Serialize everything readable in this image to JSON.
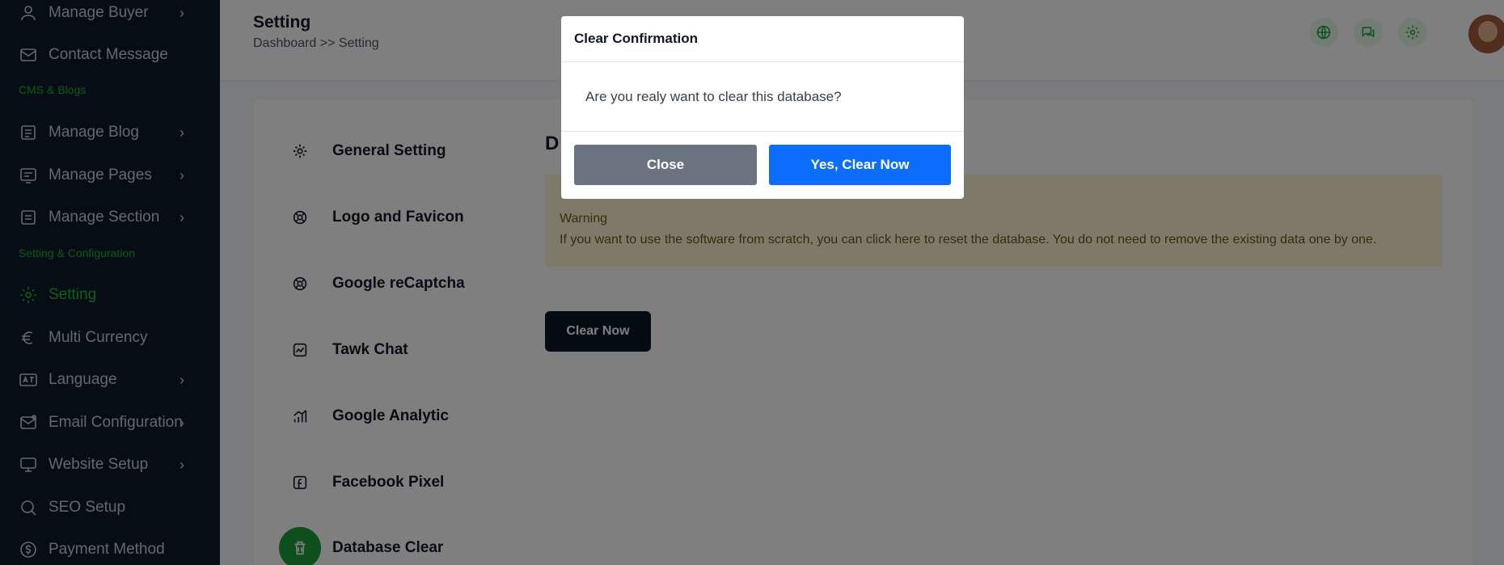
{
  "sidebar": {
    "items": [
      {
        "label": "Manage Buyer",
        "icon": "user-icon",
        "chevron": "›"
      },
      {
        "label": "Contact Message",
        "icon": "mail-icon",
        "chevron": ""
      },
      {
        "label": "Manage Blog",
        "icon": "blog-icon",
        "chevron": "›"
      },
      {
        "label": "Manage Pages",
        "icon": "pages-icon",
        "chevron": "›"
      },
      {
        "label": "Manage Section",
        "icon": "section-icon",
        "chevron": "›"
      },
      {
        "label": "Setting",
        "icon": "gear-icon",
        "chevron": ""
      },
      {
        "label": "Multi Currency",
        "icon": "currency-icon",
        "chevron": ""
      },
      {
        "label": "Language",
        "icon": "language-icon",
        "chevron": "›"
      },
      {
        "label": "Email Configuration",
        "icon": "email-config-icon",
        "chevron": "›"
      },
      {
        "label": "Website Setup",
        "icon": "monitor-icon",
        "chevron": "›"
      },
      {
        "label": "SEO Setup",
        "icon": "search-icon",
        "chevron": ""
      },
      {
        "label": "Payment Method",
        "icon": "dollar-icon",
        "chevron": ""
      }
    ],
    "sections": {
      "cms": "CMS & Blogs",
      "setting": "Setting & Configuration"
    }
  },
  "header": {
    "title": "Setting",
    "breadcrumb": "Dashboard >> Setting"
  },
  "settings_nav": [
    {
      "label": "General Setting",
      "icon": "gear-icon"
    },
    {
      "label": "Logo and Favicon",
      "icon": "logo-icon"
    },
    {
      "label": "Google reCaptcha",
      "icon": "recaptcha-icon"
    },
    {
      "label": "Tawk Chat",
      "icon": "chat-icon"
    },
    {
      "label": "Google Analytic",
      "icon": "analytics-icon"
    },
    {
      "label": "Facebook Pixel",
      "icon": "facebook-icon"
    },
    {
      "label": "Database Clear",
      "icon": "trash-icon"
    }
  ],
  "content": {
    "title": "D",
    "warning_label": "Warning",
    "warning_text": "If you want to use the software from scratch, you can click here to reset the database. You do not need to remove the existing data one by one.",
    "clear_button": "Clear Now"
  },
  "modal": {
    "title": "Clear Confirmation",
    "message": "Are you realy want to clear this database?",
    "close_label": "Close",
    "confirm_label": "Yes, Clear Now"
  },
  "colors": {
    "sidebar_bg": "#0d1b2a",
    "accent_green": "#1fbf3b",
    "primary_blue": "#0d6efd",
    "secondary_gray": "#6b7280"
  }
}
